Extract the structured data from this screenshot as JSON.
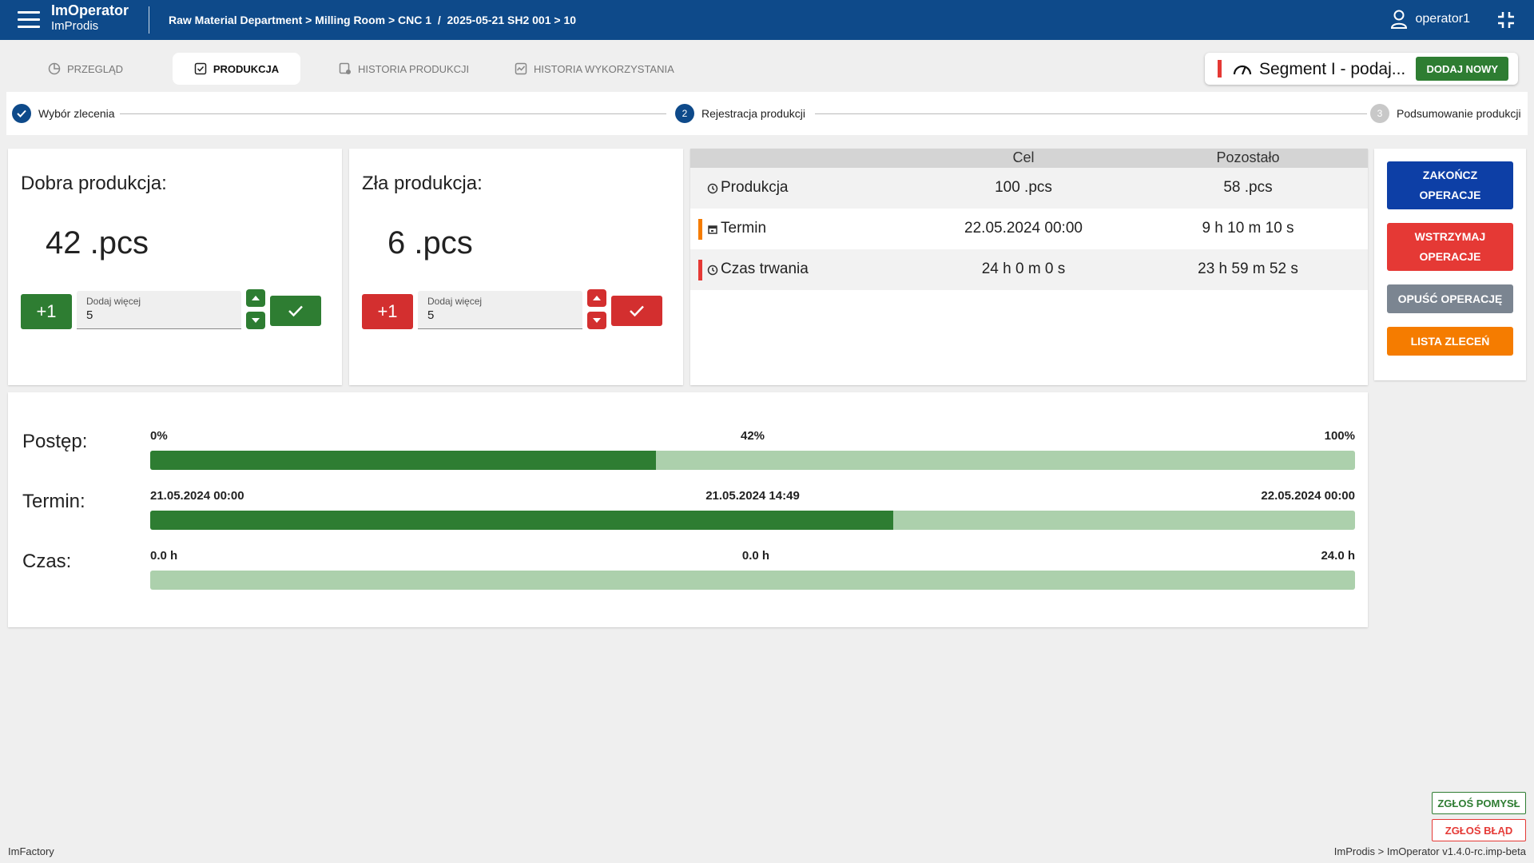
{
  "header": {
    "app_name": "ImOperator",
    "company": "ImProdis",
    "breadcrumb": "Raw Material Department > Milling Room > CNC 1  /  2025-05-21 SH2 001 > 10",
    "username": "operator1"
  },
  "tabs": [
    {
      "label": "PRZEGLĄD",
      "icon": "pie-chart-icon",
      "active": false
    },
    {
      "label": "PRODUKCJA",
      "icon": "checkbox-icon",
      "active": true
    },
    {
      "label": "HISTORIA PRODUKCJI",
      "icon": "history-icon",
      "active": false
    },
    {
      "label": "HISTORIA WYKORZYSTANIA",
      "icon": "activity-chart-icon",
      "active": false
    }
  ],
  "segment": {
    "name": "Segment I - podaj...",
    "status_color": "#e53935",
    "add_new_label": "DODAJ NOWY"
  },
  "stepper": [
    {
      "number": "1",
      "label": "Wybór zlecenia",
      "state": "done"
    },
    {
      "number": "2",
      "label": "Rejestracja produkcji",
      "state": "active"
    },
    {
      "number": "3",
      "label": "Podsumowanie produkcji",
      "state": "pending"
    }
  ],
  "good": {
    "title": "Dobra produkcja:",
    "count": "42",
    "unit": ".pcs",
    "plus_label": "+1",
    "field_label": "Dodaj więcej",
    "field_value": "5"
  },
  "bad": {
    "title": "Zła produkcja:",
    "count": "6",
    "unit": ".pcs",
    "plus_label": "+1",
    "field_label": "Dodaj więcej",
    "field_value": "5"
  },
  "targets": {
    "headers": {
      "target": "Cel",
      "remaining": "Pozostało"
    },
    "rows": [
      {
        "label": "Produkcja",
        "target": "100 .pcs",
        "remaining": "58 .pcs",
        "icon": "clock-icon",
        "marker_color": ""
      },
      {
        "label": "Termin",
        "target": "22.05.2024 00:00",
        "remaining": "9 h 10 m 10 s",
        "icon": "calendar-icon",
        "marker_color": "#f57c00"
      },
      {
        "label": "Czas trwania",
        "target": "24 h 0 m 0 s",
        "remaining": "23 h 59 m 52 s",
        "icon": "clock-icon",
        "marker_color": "#e53935"
      }
    ]
  },
  "actions": {
    "finish_line1": "ZAKOŃCZ",
    "finish_line2": "OPERACJE",
    "pause_line1": "WSTRZYMAJ",
    "pause_line2": "OPERACJE",
    "leave": "OPUŚĆ OPERACJĘ",
    "orders": "LISTA ZLECEŃ"
  },
  "progress": [
    {
      "label": "Postęp:",
      "start": "0%",
      "mid": "42%",
      "end": "100%",
      "fraction": 0.42
    },
    {
      "label": "Termin:",
      "start": "21.05.2024 00:00",
      "mid": "21.05.2024 14:49",
      "end": "22.05.2024 00:00",
      "fraction": 0.617
    },
    {
      "label": "Czas:",
      "start": "0.0 h",
      "mid": "0.0 h",
      "end": "24.0 h",
      "fraction": 0.0
    }
  ],
  "footer": {
    "idea_label": "ZGŁOŚ POMYSŁ",
    "bug_label": "ZGŁOŚ BŁĄD",
    "left_text": "ImFactory",
    "right_text": "ImProdis > ImOperator v1.4.0-rc.imp-beta"
  },
  "colors": {
    "header_bg": "#0e4a8a",
    "green": "#2e7d32",
    "red": "#d32f2f",
    "blue": "#0d3fa6",
    "gray": "#7b8591",
    "orange": "#f57c00",
    "bar_track": "#acd0ac"
  }
}
